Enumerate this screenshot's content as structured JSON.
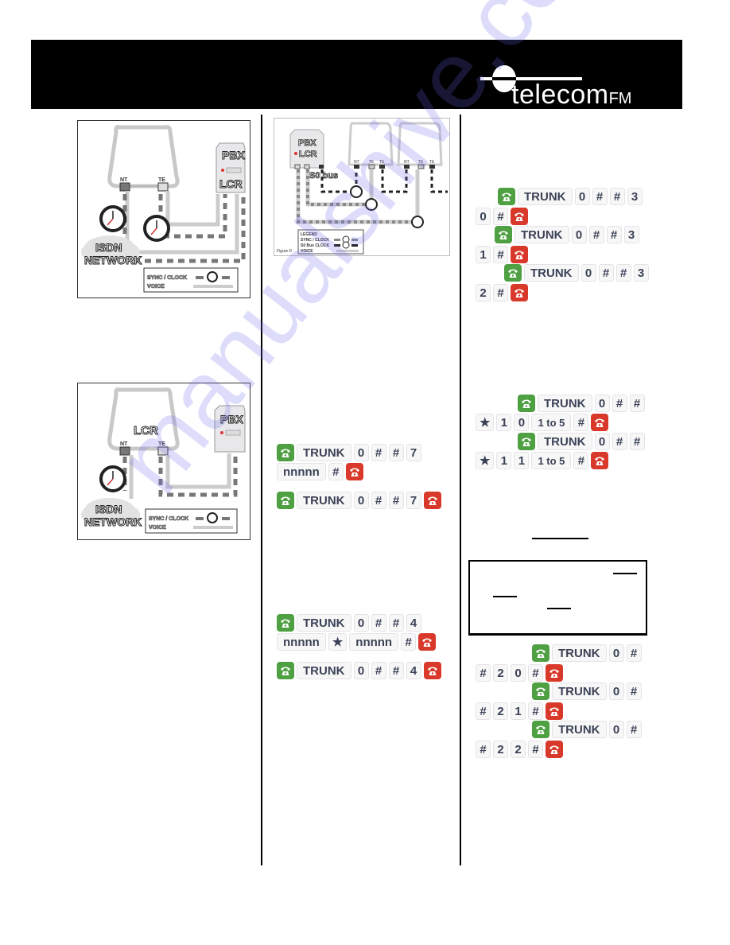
{
  "header": {
    "brand": {
      "name": "telecom",
      "suffix": "FM"
    }
  },
  "figures": {
    "fig_top_left": {
      "ports": [
        "NT",
        "TE"
      ],
      "device_labels": [
        "PBX",
        "LCR"
      ],
      "network_label": [
        "ISDN",
        "NETWORK"
      ],
      "legend": {
        "sync": "SYNC / CLOCK",
        "voice": "VOICE"
      }
    },
    "fig_bottom_left": {
      "ports": [
        "NT",
        "TE"
      ],
      "box_label": "LCR",
      "device_label": "PBX",
      "network_label": [
        "ISDN",
        "NETWORK"
      ],
      "legend": {
        "sync": "SYNC / CLOCK",
        "voice": "VOICE"
      }
    },
    "fig_d": {
      "device_labels": [
        "PBX",
        "LCR"
      ],
      "bus_label": "S0 bus",
      "ports_1": [
        "NT",
        "TE",
        "TE"
      ],
      "ports_2": [
        "NT",
        "TE",
        "TE"
      ],
      "legend": {
        "title": "LEGEND",
        "sync": "SYNC / CLOCK",
        "s0": "S0 Bus CLOCK",
        "voice": "VOICE"
      },
      "caption": "Figure D"
    }
  },
  "sequences": {
    "seq_7_set": [
      [
        "off-hook",
        "TRUNK",
        "0",
        "#",
        "#",
        "7"
      ],
      [
        "nnnnn",
        "#",
        "on-hook"
      ]
    ],
    "seq_7_clear": [
      [
        "off-hook",
        "TRUNK",
        "0",
        "#",
        "#",
        "7",
        "on-hook"
      ]
    ],
    "seq_4_set": [
      [
        "off-hook",
        "TRUNK",
        "0",
        "#",
        "#",
        "4"
      ],
      [
        "nnnnn",
        "★",
        "nnnnn",
        "#",
        "on-hook"
      ]
    ],
    "seq_4_clear": [
      [
        "off-hook",
        "TRUNK",
        "0",
        "#",
        "#",
        "4",
        "on-hook"
      ]
    ],
    "seq_3_0": [
      [
        "off-hook",
        "TRUNK",
        "0",
        "#",
        "#",
        "3"
      ],
      [
        "0",
        "#",
        "on-hook"
      ]
    ],
    "seq_3_1": [
      [
        "off-hook",
        "TRUNK",
        "0",
        "#",
        "#",
        "3"
      ],
      [
        "1",
        "#",
        "on-hook"
      ]
    ],
    "seq_3_2": [
      [
        "off-hook",
        "TRUNK",
        "0",
        "#",
        "#",
        "3"
      ],
      [
        "2",
        "#",
        "on-hook"
      ]
    ],
    "seq_star_10": [
      [
        "off-hook",
        "TRUNK",
        "0",
        "#",
        "#"
      ],
      [
        "★",
        "1",
        "0",
        "1 to 5",
        "#",
        "on-hook"
      ]
    ],
    "seq_star_11": [
      [
        "off-hook",
        "TRUNK",
        "0",
        "#",
        "#"
      ],
      [
        "★",
        "1",
        "1",
        "1 to 5",
        "#",
        "on-hook"
      ]
    ],
    "seq_2_0": [
      [
        "off-hook",
        "TRUNK",
        "0",
        "#"
      ],
      [
        "#",
        "2",
        "0",
        "#",
        "on-hook"
      ]
    ],
    "seq_2_1": [
      [
        "off-hook",
        "TRUNK",
        "0",
        "#"
      ],
      [
        "#",
        "2",
        "1",
        "#",
        "on-hook"
      ]
    ],
    "seq_2_2": [
      [
        "off-hook",
        "TRUNK",
        "0",
        "#"
      ],
      [
        "#",
        "2",
        "2",
        "#",
        "on-hook"
      ]
    ]
  },
  "colors": {
    "off_hook": "#4fa043",
    "on_hook": "#d9392a",
    "key_text": "#3c4256"
  },
  "watermark": "manualshive.com"
}
